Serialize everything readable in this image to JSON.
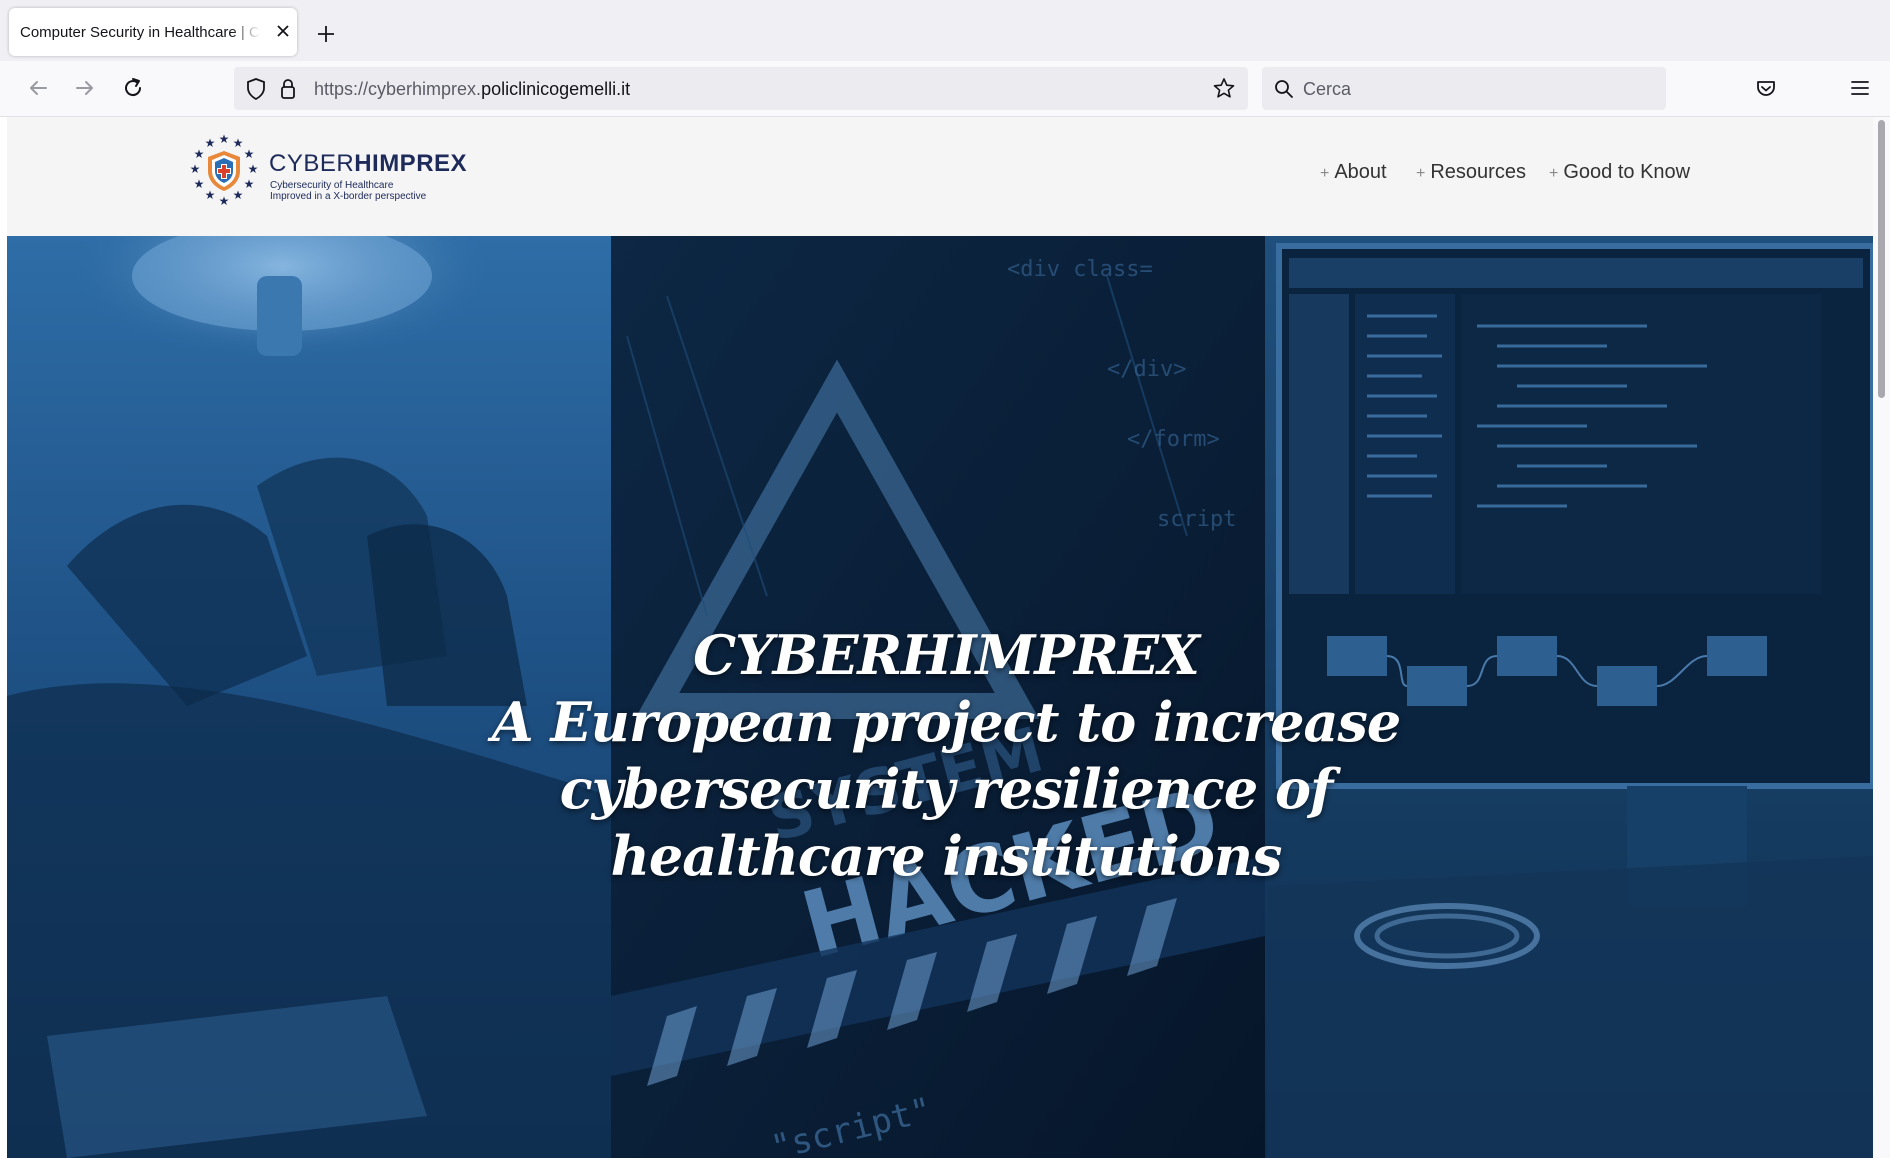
{
  "browser": {
    "tab_title": "Computer Security in Healthcare | CYBERHIMPREX",
    "url_prefix": "https://cyberhimprex.",
    "url_domain": "policlinicogemelli.it",
    "search_placeholder": "Cerca"
  },
  "site": {
    "logo_name_light": "CYBER",
    "logo_name_bold": "HIMPREX",
    "logo_sub_1": "Cybersecurity of Healthcare",
    "logo_sub_2": "Improved in a X-border perspective",
    "nav": [
      {
        "label": "About"
      },
      {
        "label": "Resources"
      },
      {
        "label": "Good to Know"
      }
    ]
  },
  "hero": {
    "line_1": "CYBERHIMPREX",
    "line_2": "A European project to increase",
    "line_3": "cybersecurity resilience of",
    "line_4": "healthcare institutions",
    "panel_text_hacked": "HACKED",
    "panel_text_system": "SYSTEM",
    "panel_code_1": "<div class=",
    "panel_code_2": "</div>",
    "panel_code_3": "</form>",
    "panel_code_4": "script",
    "panel_code_5": "\"script\""
  },
  "colors": {
    "tab_bg": "#f0f0f4",
    "toolbar_bg": "#f9f9fb",
    "urlbar_bg": "#ececf0",
    "header_bg": "#f5f5f5",
    "logo_blue": "#1d2a5a",
    "hero_blue": "#1a4a7a"
  }
}
